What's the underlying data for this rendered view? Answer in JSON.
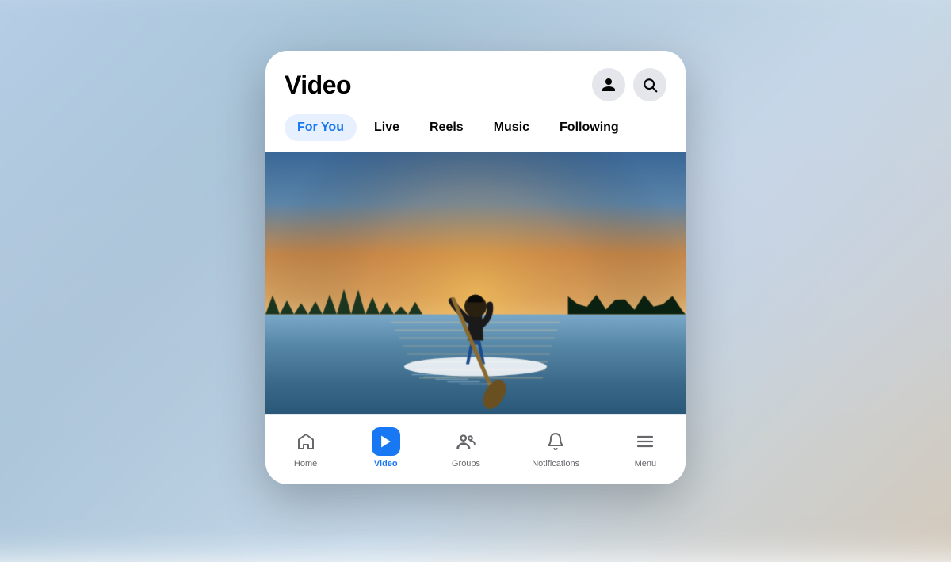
{
  "header": {
    "title": "Video",
    "profile_icon": "person-icon",
    "search_icon": "search-icon"
  },
  "tabs": [
    {
      "label": "For You",
      "active": true
    },
    {
      "label": "Live",
      "active": false
    },
    {
      "label": "Reels",
      "active": false
    },
    {
      "label": "Music",
      "active": false
    },
    {
      "label": "Following",
      "active": false
    }
  ],
  "video": {
    "description": "Paddleboarding at sunset"
  },
  "bottom_nav": [
    {
      "label": "Home",
      "icon": "home-icon",
      "active": false
    },
    {
      "label": "Video",
      "icon": "video-icon",
      "active": true
    },
    {
      "label": "Groups",
      "icon": "groups-icon",
      "active": false
    },
    {
      "label": "Notifications",
      "icon": "bell-icon",
      "active": false
    },
    {
      "label": "Menu",
      "icon": "menu-icon",
      "active": false
    }
  ]
}
